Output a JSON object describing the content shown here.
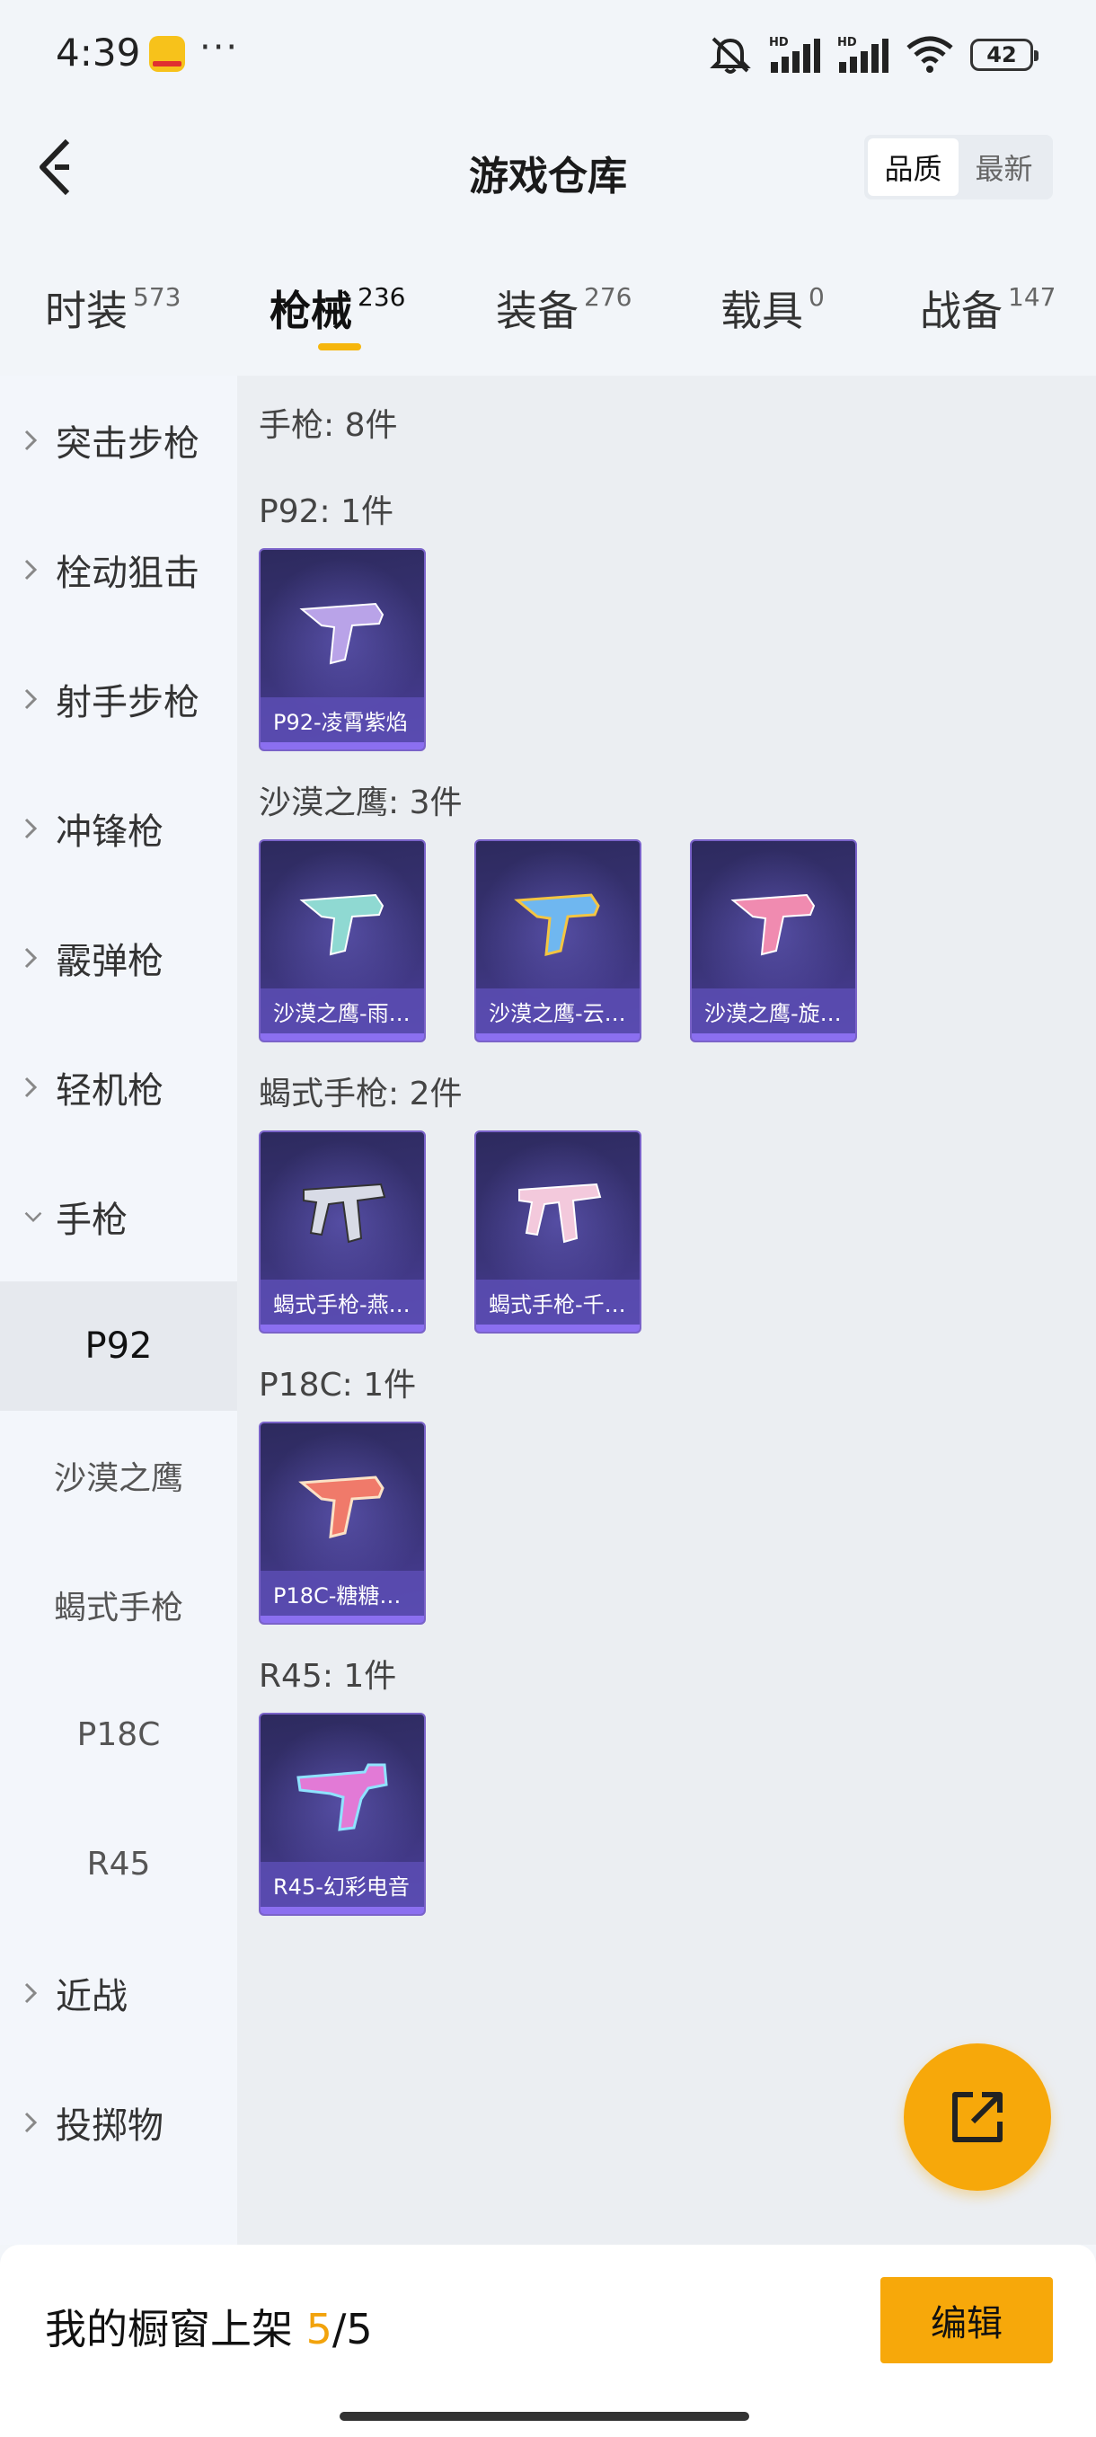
{
  "status_bar": {
    "time": "4:39",
    "dots": "···",
    "battery": "42",
    "icons": [
      "mute-bell-icon",
      "hd-signal-icon",
      "hd-signal-icon",
      "wifi-icon",
      "battery-icon"
    ]
  },
  "header": {
    "title": "游戏仓库",
    "sort_options": [
      "品质",
      "最新"
    ],
    "active_sort": "品质"
  },
  "category_tabs": [
    {
      "label": "时装",
      "count": "573"
    },
    {
      "label": "枪械",
      "count": "236",
      "active": true
    },
    {
      "label": "装备",
      "count": "276"
    },
    {
      "label": "载具",
      "count": "0"
    },
    {
      "label": "战备",
      "count": "147"
    }
  ],
  "sidebar": {
    "items": [
      {
        "label": "突击步枪"
      },
      {
        "label": "栓动狙击"
      },
      {
        "label": "射手步枪"
      },
      {
        "label": "冲锋枪"
      },
      {
        "label": "霰弹枪"
      },
      {
        "label": "轻机枪"
      },
      {
        "label": "手枪",
        "expanded": true
      },
      {
        "label": "近战"
      },
      {
        "label": "投掷物"
      }
    ],
    "sub_items": [
      {
        "label": "P92",
        "active": true
      },
      {
        "label": "沙漠之鹰"
      },
      {
        "label": "蝎式手枪"
      },
      {
        "label": "P18C"
      },
      {
        "label": "R45"
      }
    ]
  },
  "content": {
    "section_title": "手枪: 8件",
    "groups": [
      {
        "title": "P92: 1件",
        "cards": [
          {
            "name": "P92-凌霄紫焰",
            "color": "#b9a3e8"
          }
        ]
      },
      {
        "title": "沙漠之鹰: 3件",
        "cards": [
          {
            "name": "沙漠之鹰-雨…",
            "color": "#8fd9d2"
          },
          {
            "name": "沙漠之鹰-云…",
            "color": "#6fb7f0"
          },
          {
            "name": "沙漠之鹰-旋…",
            "color": "#f08bb0"
          }
        ]
      },
      {
        "title": "蝎式手枪: 2件",
        "cards": [
          {
            "name": "蝎式手枪-燕…",
            "color": "#d8dbe6"
          },
          {
            "name": "蝎式手枪-千…",
            "color": "#f3c9dc"
          }
        ]
      },
      {
        "title": "P18C: 1件",
        "cards": [
          {
            "name": "P18C-糖糖…",
            "color": "#f07a6a"
          }
        ]
      },
      {
        "title": "R45: 1件",
        "cards": [
          {
            "name": "R45-幻彩电音",
            "color": "#e27ad6"
          }
        ]
      }
    ]
  },
  "bottom_bar": {
    "showcase_label": "我的橱窗上架",
    "current": "5",
    "separator": "/",
    "total": "5",
    "edit_label": "编辑"
  },
  "colors": {
    "accent": "#f7a80a",
    "card_border": "#7a63c9",
    "card_label_bg": "#5c4eb4"
  }
}
